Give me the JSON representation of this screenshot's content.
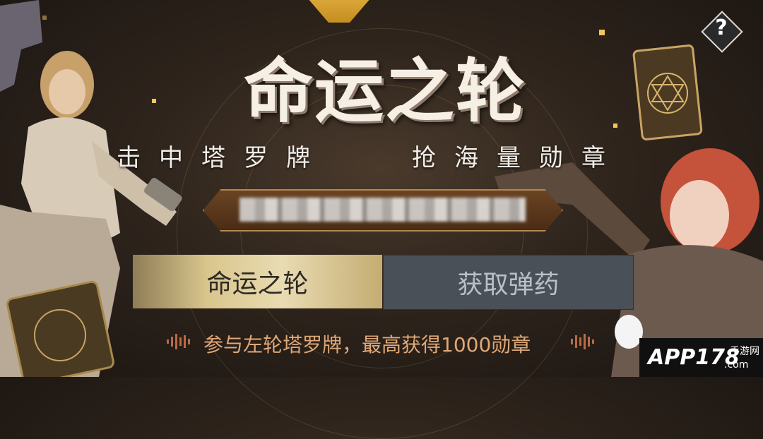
{
  "title": "命运之轮",
  "subtitle_left": "击中塔罗牌",
  "subtitle_right": "抢海量勋章",
  "help_label": "?",
  "tabs": [
    {
      "label": "命运之轮",
      "active": true
    },
    {
      "label": "获取弹药",
      "active": false
    }
  ],
  "footer": "参与左轮塔罗牌，最高获得1000勋章",
  "watermark": {
    "brand": "APP178",
    "site": ".com",
    "tag": "手游网"
  },
  "colors": {
    "accent_gold": "#d9c68d",
    "tab_inactive": "#4a5058",
    "footer_text": "#e0a877"
  }
}
